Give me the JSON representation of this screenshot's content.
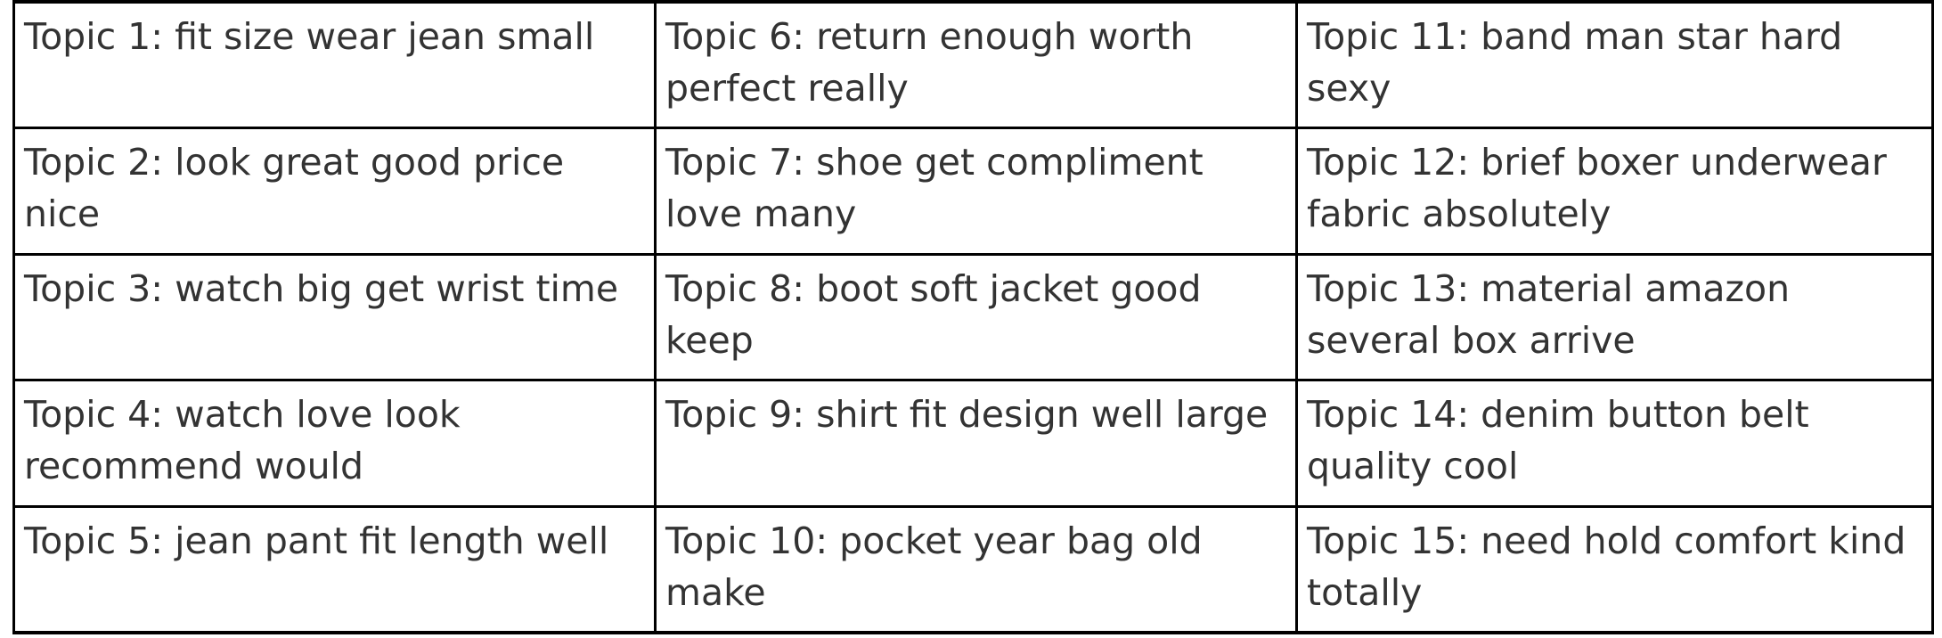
{
  "rows": [
    [
      "Topic 1: fit size wear jean small",
      "Topic 6: return enough worth perfect really",
      "Topic 11: band man star hard sexy"
    ],
    [
      "Topic 2: look great good price nice",
      "Topic 7: shoe get compliment love many",
      "Topic 12: brief boxer underwear fabric absolutely"
    ],
    [
      "Topic 3: watch big get wrist time",
      "Topic 8: boot soft jacket good keep",
      "Topic 13: material amazon several box arrive"
    ],
    [
      "Topic 4: watch love look recommend would",
      "Topic 9: shirt fit design well large",
      "Topic 14: denim button belt quality cool"
    ],
    [
      "Topic 5: jean pant fit length well",
      "Topic 10: pocket year bag old make",
      "Topic 15: need hold comfort kind totally"
    ]
  ]
}
